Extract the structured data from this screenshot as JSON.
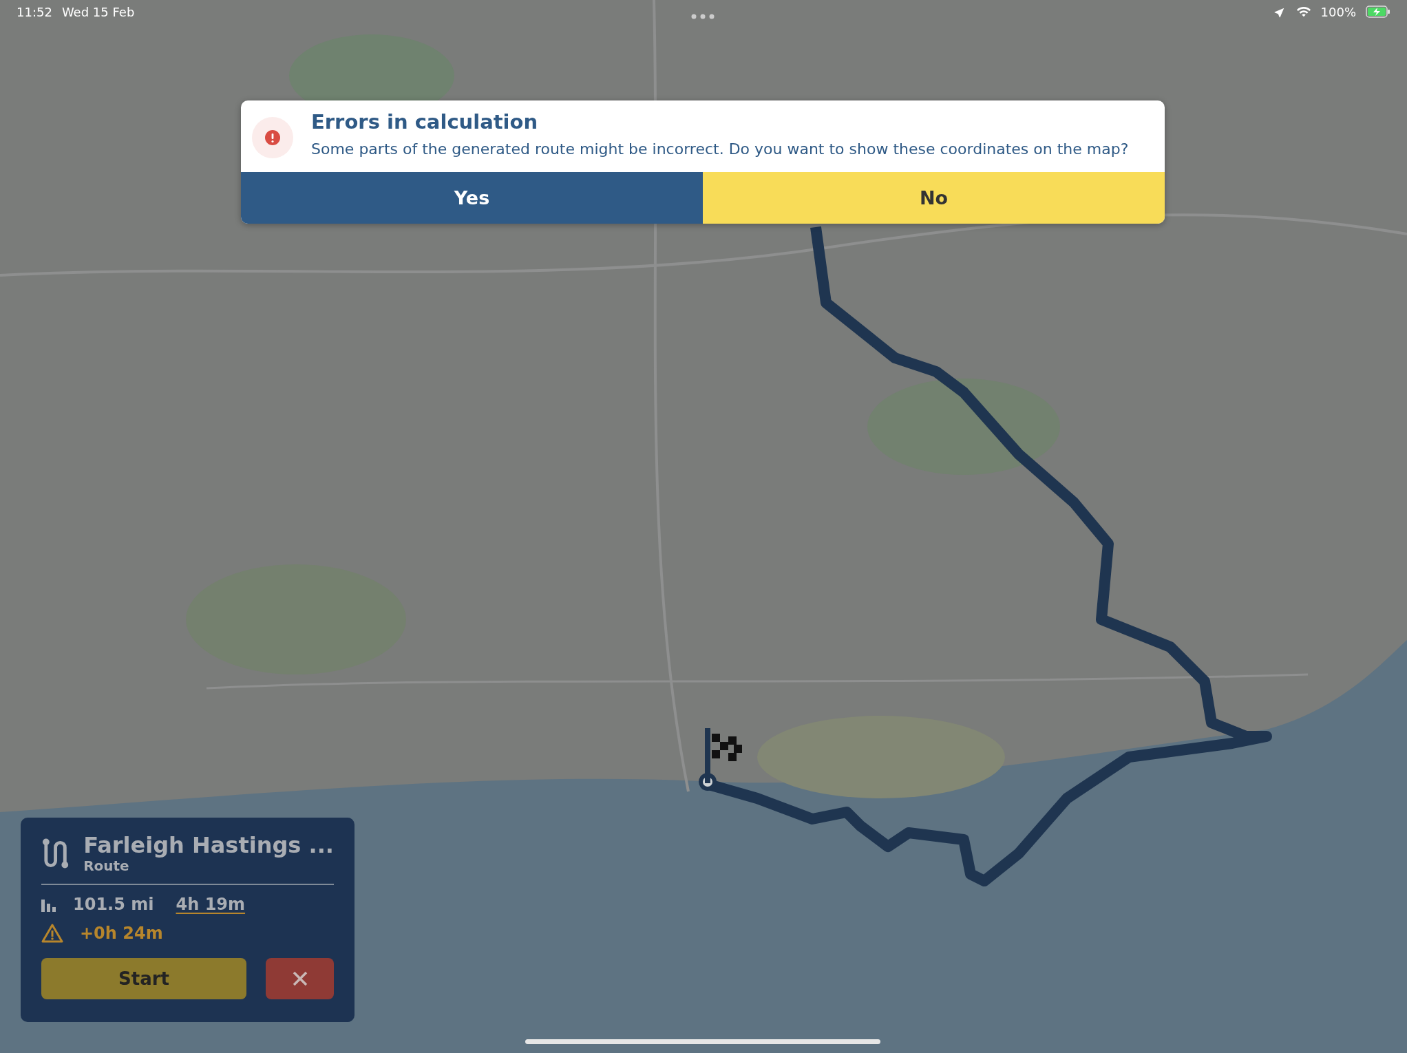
{
  "status_bar": {
    "time": "11:52",
    "date": "Wed 15 Feb",
    "battery": "100%"
  },
  "dialog": {
    "title": "Errors in calculation",
    "message": "Some parts of the generated route might be incorrect. Do you want to show these coordinates on the map?",
    "buttons": [
      {
        "label": "Yes",
        "kind": "primary"
      },
      {
        "label": "No",
        "kind": "secondary"
      }
    ]
  },
  "route_card": {
    "title": "Farleigh Hastings ...",
    "subtitle": "Route",
    "distance": "101.5 mi",
    "duration": "4h 19m",
    "delay": "+0h 24m",
    "start_button": "Start"
  }
}
